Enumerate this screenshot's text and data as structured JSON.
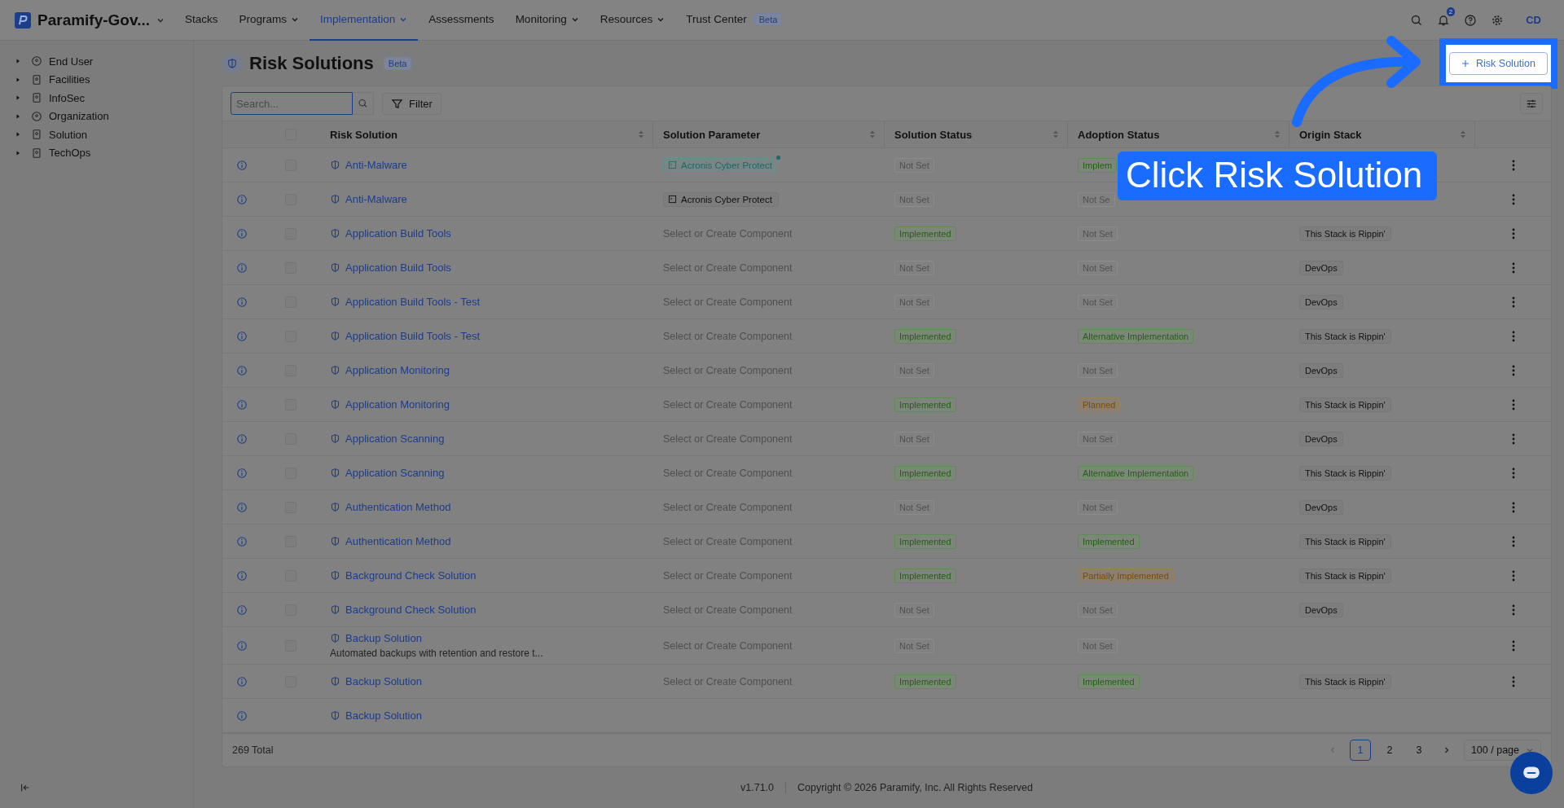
{
  "app": {
    "name": "Paramify-Gov..."
  },
  "nav": [
    {
      "label": "Stacks",
      "dropdown": false,
      "selected": false
    },
    {
      "label": "Programs",
      "dropdown": true,
      "selected": false
    },
    {
      "label": "Implementation",
      "dropdown": true,
      "selected": true
    },
    {
      "label": "Assessments",
      "dropdown": false,
      "selected": false
    },
    {
      "label": "Monitoring",
      "dropdown": true,
      "selected": false
    },
    {
      "label": "Resources",
      "dropdown": true,
      "selected": false
    },
    {
      "label": "Trust Center",
      "dropdown": false,
      "selected": false,
      "badge": "Beta"
    }
  ],
  "notifications": {
    "count": "2"
  },
  "user": {
    "initials": "CD"
  },
  "sidebar": {
    "items": [
      {
        "label": "End User",
        "expanded": false
      },
      {
        "label": "Facilities",
        "expanded": false
      },
      {
        "label": "InfoSec",
        "expanded": false
      },
      {
        "label": "Organization",
        "expanded": false
      },
      {
        "label": "Solution",
        "expanded": false
      },
      {
        "label": "TechOps",
        "expanded": false
      }
    ]
  },
  "page": {
    "title": "Risk Solutions",
    "badge": "Beta",
    "add_button": "Risk Solution"
  },
  "search": {
    "placeholder": "Search...",
    "focused": true
  },
  "filter_button": "Filter",
  "table": {
    "select_all": false,
    "columns": [
      "Risk Solution",
      "Solution Parameter",
      "Solution Status",
      "Adoption Status",
      "Origin Stack"
    ],
    "rows": [
      {
        "name": "Anti-Malware",
        "checked": false,
        "parameter": {
          "kind": "component",
          "text": "Acronis Cyber Protect",
          "marked": true
        },
        "solution_status": {
          "text": "Not Set",
          "kind": "not_set"
        },
        "adoption_status": {
          "text": "Implem",
          "kind": "implemented"
        }
      },
      {
        "name": "Anti-Malware",
        "checked": false,
        "parameter": {
          "kind": "component",
          "text": "Acronis Cyber Protect",
          "marked": false
        },
        "solution_status": {
          "text": "Not Set",
          "kind": "not_set"
        },
        "adoption_status": {
          "text": "Not Se",
          "kind": "not_set"
        }
      },
      {
        "name": "Application Build Tools",
        "checked": false,
        "parameter": {
          "kind": "placeholder",
          "text": "Select or Create Component"
        },
        "solution_status": {
          "text": "Implemented",
          "kind": "implemented"
        },
        "adoption_status": {
          "text": "Not Set",
          "kind": "not_set"
        },
        "origin_stack": "This Stack is Rippin'"
      },
      {
        "name": "Application Build Tools",
        "checked": false,
        "parameter": {
          "kind": "placeholder",
          "text": "Select or Create Component"
        },
        "solution_status": {
          "text": "Not Set",
          "kind": "not_set"
        },
        "adoption_status": {
          "text": "Not Set",
          "kind": "not_set"
        },
        "origin_stack": "DevOps"
      },
      {
        "name": "Application Build Tools - Test",
        "checked": false,
        "parameter": {
          "kind": "placeholder",
          "text": "Select or Create Component"
        },
        "solution_status": {
          "text": "Not Set",
          "kind": "not_set"
        },
        "adoption_status": {
          "text": "Not Set",
          "kind": "not_set"
        },
        "origin_stack": "DevOps"
      },
      {
        "name": "Application Build Tools - Test",
        "checked": false,
        "parameter": {
          "kind": "placeholder",
          "text": "Select or Create Component"
        },
        "solution_status": {
          "text": "Implemented",
          "kind": "implemented"
        },
        "adoption_status": {
          "text": "Alternative Implementation",
          "kind": "alternative"
        },
        "origin_stack": "This Stack is Rippin'"
      },
      {
        "name": "Application Monitoring",
        "checked": false,
        "parameter": {
          "kind": "placeholder",
          "text": "Select or Create Component"
        },
        "solution_status": {
          "text": "Not Set",
          "kind": "not_set"
        },
        "adoption_status": {
          "text": "Not Set",
          "kind": "not_set"
        },
        "origin_stack": "DevOps"
      },
      {
        "name": "Application Monitoring",
        "checked": false,
        "parameter": {
          "kind": "placeholder",
          "text": "Select or Create Component"
        },
        "solution_status": {
          "text": "Implemented",
          "kind": "implemented"
        },
        "adoption_status": {
          "text": "Planned",
          "kind": "planned"
        },
        "origin_stack": "This Stack is Rippin'"
      },
      {
        "name": "Application Scanning",
        "checked": false,
        "parameter": {
          "kind": "placeholder",
          "text": "Select or Create Component"
        },
        "solution_status": {
          "text": "Not Set",
          "kind": "not_set"
        },
        "adoption_status": {
          "text": "Not Set",
          "kind": "not_set"
        },
        "origin_stack": "DevOps"
      },
      {
        "name": "Application Scanning",
        "checked": false,
        "parameter": {
          "kind": "placeholder",
          "text": "Select or Create Component"
        },
        "solution_status": {
          "text": "Implemented",
          "kind": "implemented"
        },
        "adoption_status": {
          "text": "Alternative Implementation",
          "kind": "alternative"
        },
        "origin_stack": "This Stack is Rippin'"
      },
      {
        "name": "Authentication Method",
        "checked": false,
        "parameter": {
          "kind": "placeholder",
          "text": "Select or Create Component"
        },
        "solution_status": {
          "text": "Not Set",
          "kind": "not_set"
        },
        "adoption_status": {
          "text": "Not Set",
          "kind": "not_set"
        },
        "origin_stack": "DevOps"
      },
      {
        "name": "Authentication Method",
        "checked": false,
        "parameter": {
          "kind": "placeholder",
          "text": "Select or Create Component"
        },
        "solution_status": {
          "text": "Implemented",
          "kind": "implemented"
        },
        "adoption_status": {
          "text": "Implemented",
          "kind": "implemented"
        },
        "origin_stack": "This Stack is Rippin'"
      },
      {
        "name": "Background Check Solution",
        "checked": false,
        "parameter": {
          "kind": "placeholder",
          "text": "Select or Create Component"
        },
        "solution_status": {
          "text": "Implemented",
          "kind": "implemented"
        },
        "adoption_status": {
          "text": "Partially Implemented",
          "kind": "partial"
        },
        "origin_stack": "This Stack is Rippin'"
      },
      {
        "name": "Background Check Solution",
        "checked": false,
        "parameter": {
          "kind": "placeholder",
          "text": "Select or Create Component"
        },
        "solution_status": {
          "text": "Not Set",
          "kind": "not_set"
        },
        "adoption_status": {
          "text": "Not Set",
          "kind": "not_set"
        },
        "origin_stack": "DevOps"
      },
      {
        "name": "Backup Solution",
        "description": "Automated backups with retention and restore t...",
        "checked": false,
        "parameter": {
          "kind": "placeholder",
          "text": "Select or Create Component"
        },
        "solution_status": {
          "text": "Not Set",
          "kind": "not_set"
        },
        "adoption_status": {
          "text": "Not Set",
          "kind": "not_set"
        }
      },
      {
        "name": "Backup Solution",
        "checked": false,
        "parameter": {
          "kind": "placeholder",
          "text": "Select or Create Component"
        },
        "solution_status": {
          "text": "Implemented",
          "kind": "implemented"
        },
        "adoption_status": {
          "text": "Implemented",
          "kind": "implemented"
        },
        "origin_stack": "This Stack is Rippin'"
      },
      {
        "name": "Backup Solution"
      }
    ]
  },
  "total": "269 Total",
  "pagination": {
    "pages": [
      {
        "label": "1",
        "selected": true
      },
      {
        "label": "2",
        "selected": false
      },
      {
        "label": "3",
        "selected": false
      }
    ],
    "page_size": "100 / page"
  },
  "footer": {
    "version": "v1.71.0",
    "copyright": "Copyright © 2026 Paramify, Inc. All Rights Reserved"
  },
  "callout": {
    "text": "Click Risk Solution"
  }
}
